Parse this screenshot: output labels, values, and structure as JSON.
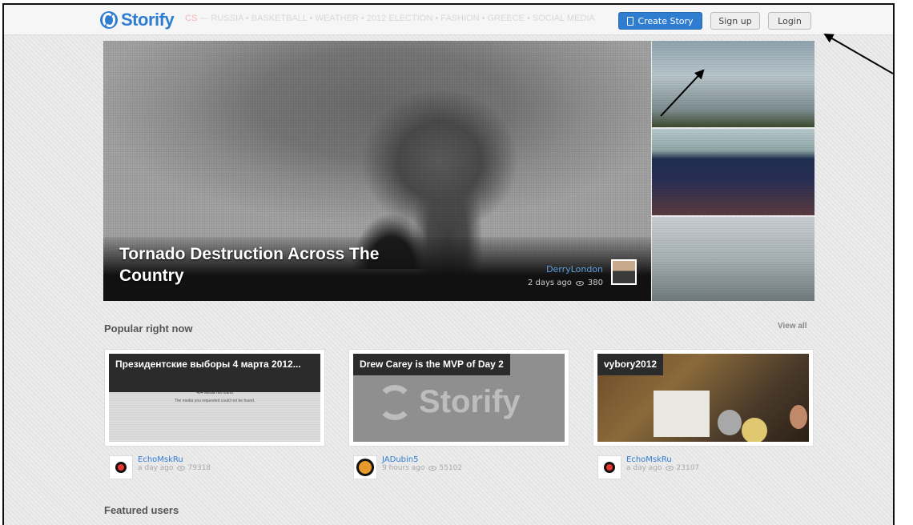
{
  "header": {
    "logo": "Storify",
    "topics_hot": "CS",
    "topics": " — RUSSIA • BASKETBALL • WEATHER • 2012 ELECTION • FASHION • GREECE • SOCIAL MEDIA",
    "create_story": "Create Story",
    "sign_up": "Sign up",
    "login": "Login"
  },
  "hero": {
    "title": "Tornado Destruction Across The Country",
    "author": "DerryLondon",
    "time": "2 days ago",
    "views": "380"
  },
  "popular": {
    "title": "Popular right now",
    "view_all": "View all",
    "cards": [
      {
        "title": "Президентские выборы 4 марта 2012...",
        "msg1": "404 Media not found",
        "msg2": "The media you requested could not be found.",
        "author": "EchoMskRu",
        "time": "a day ago",
        "views": "79318"
      },
      {
        "title": "Drew Carey is the MVP of Day 2",
        "logo": "Storify",
        "author": "JADubin5",
        "time": "9 hours ago",
        "views": "55102"
      },
      {
        "title": "vybory2012",
        "author": "EchoMskRu",
        "time": "a day ago",
        "views": "23107"
      }
    ]
  },
  "featured": {
    "title": "Featured users"
  }
}
